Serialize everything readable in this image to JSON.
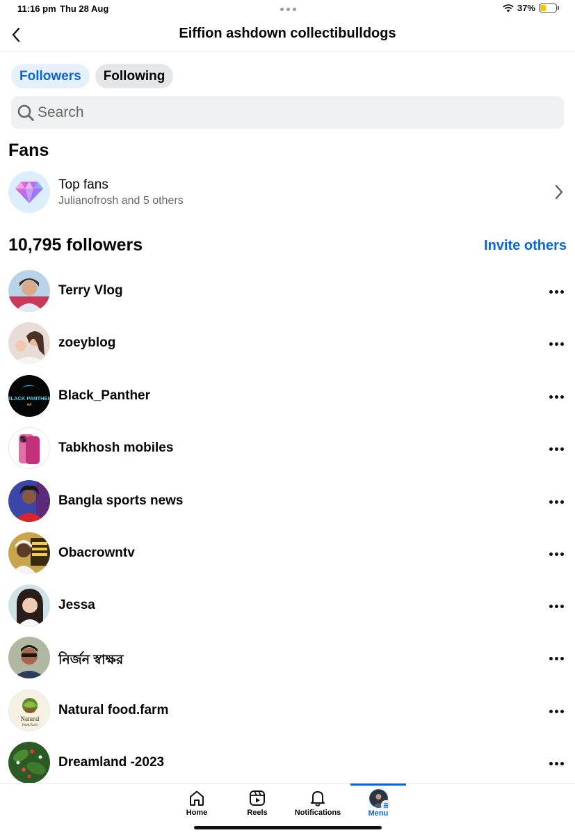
{
  "status_bar": {
    "time": "11:16 pm",
    "date": "Thu 28 Aug",
    "battery": "37%",
    "battery_level": 0.37
  },
  "header": {
    "title": "Eiffion ashdown collectibulldogs"
  },
  "tabs": [
    {
      "label": "Followers",
      "active": true
    },
    {
      "label": "Following",
      "active": false
    }
  ],
  "search": {
    "placeholder": "Search",
    "value": ""
  },
  "fans": {
    "heading": "Fans",
    "top_fans": {
      "title": "Top fans",
      "subtitle": "Julianofrosh and 5 others",
      "icon": "diamond-icon"
    }
  },
  "followers": {
    "count_label": "10,795 followers",
    "invite_label": "Invite others",
    "items": [
      {
        "name": "Terry Vlog"
      },
      {
        "name": "zoeyblog"
      },
      {
        "name": "Black_Panther",
        "avatar_text": "BLACK PANTHER"
      },
      {
        "name": "Tabkhosh mobiles"
      },
      {
        "name": "Bangla sports news"
      },
      {
        "name": "Obacrowntv"
      },
      {
        "name": "Jessa"
      },
      {
        "name": "নির্জন স্বাক্ষর"
      },
      {
        "name": "Natural food.farm",
        "avatar_text": "Natural"
      },
      {
        "name": "Dreamland -2023"
      }
    ]
  },
  "bottom_nav": [
    {
      "label": "Home",
      "icon": "home-icon",
      "active": false
    },
    {
      "label": "Reels",
      "icon": "reels-icon",
      "active": false
    },
    {
      "label": "Notifications",
      "icon": "bell-icon",
      "active": false
    },
    {
      "label": "Menu",
      "icon": "profile-avatar",
      "active": true
    }
  ],
  "colors": {
    "accent": "#0866d6",
    "text": "#050505",
    "secondary_text": "#65676b",
    "search_bg": "#eef0f2"
  }
}
